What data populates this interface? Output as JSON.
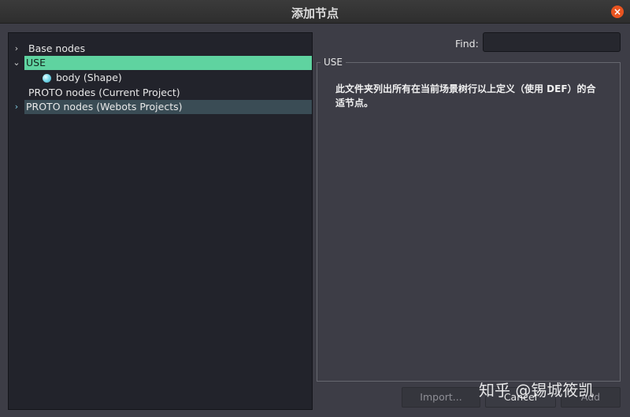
{
  "window": {
    "title": "添加节点"
  },
  "tree": {
    "items": [
      {
        "label": "Base nodes",
        "arrow": "›",
        "state": "normal"
      },
      {
        "label": "USE",
        "arrow": "⌄",
        "state": "selected"
      },
      {
        "label": "body (Shape)",
        "arrow": "",
        "state": "child"
      },
      {
        "label": "PROTO nodes (Current Project)",
        "arrow": "",
        "state": "normal"
      },
      {
        "label": "PROTO nodes (Webots Projects)",
        "arrow": "›",
        "state": "hover"
      }
    ]
  },
  "find": {
    "label": "Find:",
    "value": ""
  },
  "info": {
    "title": "USE",
    "description": "此文件夹列出所有在当前场景树行以上定义（使用 DEF）的合适节点。"
  },
  "buttons": {
    "import": "Import...",
    "cancel": "Cancel",
    "add": "Add"
  },
  "watermark": "知乎 @锡城筱凯",
  "colors": {
    "selected": "#5fd3a0",
    "close": "#e95420"
  }
}
